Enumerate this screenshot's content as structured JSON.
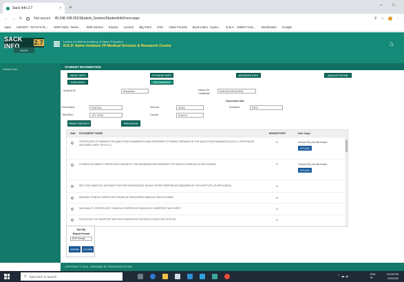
{
  "browser": {
    "tab_title": "Sack Info 2.7",
    "new_tab": "+",
    "security": "Not secure",
    "url": "49.248.198.201/Student_Section/StudentInfoForm.aspx",
    "bookmarks": [
      "Apps",
      "LEKSNY - BYJU'S PL...",
      "MSN India - News...",
      "Web Games",
      "Empire",
      "Lecture",
      "Big Farm",
      "GOL",
      "Clear Friends",
      "Book Index - Kyoto...",
      "E.B.A. - MINAT HUL...",
      "Bookmarks",
      "Google"
    ],
    "window_controls": [
      "–",
      "□"
    ]
  },
  "app": {
    "logo": "SACK INFO",
    "logo_version": "2.7",
    "logo_sub": "MVPS",
    "org_tagline": "Lecture to Lifetime Academy of Higher Education",
    "org_name": "N.K.P. Salve Institute Of Medical Science & Research Centre",
    "sidebar_item": "Student Info",
    "section_title": "STUDENT INFORMATION",
    "footer_text": "COPYRIGHT © 2019 - DESIGNED BY SYNTHESIS SYS INC"
  },
  "tabs": {
    "basic_info": "BASIC INFO",
    "student_info": "STUDENT INFO",
    "address_info": "ADDRESS INFO",
    "qualification": "QUALIFICATION",
    "fees_info": "FEES INFO",
    "documents": "DOCUMENTS"
  },
  "form": {
    "student_id_label": "Student ID",
    "student_id_value": "Mustubhai",
    "name_label": "Name On Certificate",
    "name_value": "RAKSHA ASHA PATIL",
    "document_info": "Document Info",
    "first_label": "First Name",
    "first_value": "RAKSHA",
    "second_label": "Second",
    "second_value": "ASHA",
    "surname_label": "Surname",
    "surname_value": "PATIL",
    "year_label": "Year/Sem",
    "year_value": "1ST YEAR",
    "course_label": "Course",
    "course_value": "M.B.B.S",
    "print_receipt": "PRINT RECEIPT",
    "previous": "PREVIOUS"
  },
  "documents": {
    "col_select": "Add",
    "col_name": "DOCUMENT NAME",
    "col_mandatory": "MANDATORY",
    "col_copy": "Doc Copy",
    "rows": [
      {
        "name": "CERTIFICATE OF PASSING THE QUALIFYING EXAMINATION AND STATEMENT OF MARKS OBTAINED IN THE QUALIFYING EXAMINATION (H.S.C. CERTIFICATE AND MARK SHEET OF H.S.C.)",
        "mandatory": "N",
        "file_status": "Choose File | No file chosen",
        "upload": "UPLOAD"
      },
      {
        "name": "STUDENT ELIGIBILITY CERTIFICATE ISSUED BY THE MAHARASHTRA UNIVERSITY OF HEALTH SCIENCES (IF APPLICABLE)",
        "mandatory": "N",
        "file_status": "Choose File | No file chosen",
        "upload": "UPLOAD"
      },
      {
        "name": "SELF DECLARATION / AFFIDAVIT FOR GAP IN EDUCATION OR ANY OTHER PURPOSE AS REQUIRED BY THE INSTITUTE (IF APPLICABLE)",
        "mandatory": "N"
      },
      {
        "name": "MEDICAL FITNESS CERTIFICATE ISSUED BY REGISTERED MEDICAL PRACTITIONER",
        "mandatory": "N"
      },
      {
        "name": "NATIONALITY CERTIFICATE / DOMICILE CERTIFICATE ISSUED BY COMPETENT AUTHORITY",
        "mandatory": "N"
      },
      {
        "name": "PHOTOCOPY OF PASSPORT SIZE PHOTOGRAPHS ATTESTED BY GAZETTED OFFICER",
        "mandatory": "N"
      }
    ]
  },
  "report": {
    "sort_by": "Sort By",
    "report_format": "Report Format",
    "format_value": "PDF Format",
    "show": "SHOW",
    "close": "CLOSE"
  },
  "taskbar": {
    "search_placeholder": "Type here to search",
    "lang": "ENG",
    "region": "IN",
    "time": "12:09 PM",
    "date": "6/2/2020"
  }
}
